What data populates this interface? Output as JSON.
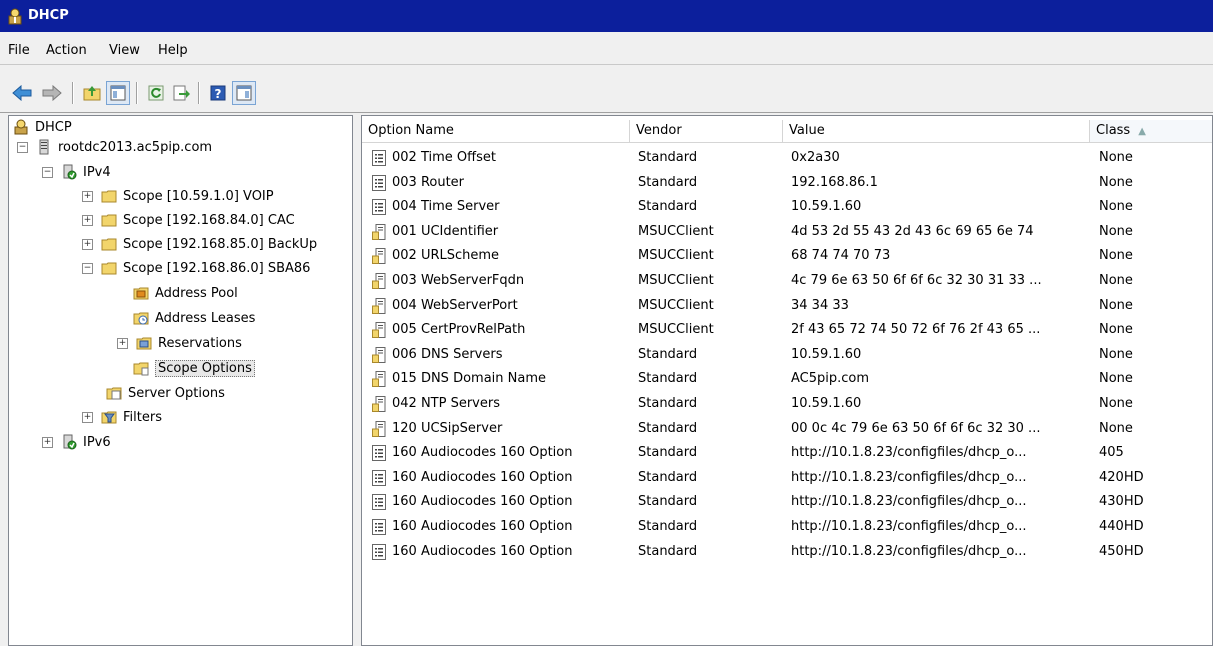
{
  "window": {
    "title": "DHCP"
  },
  "menu": [
    "File",
    "Action",
    "View",
    "Help"
  ],
  "toolbar": [
    "back-icon",
    "forward-icon",
    "up-folder-icon",
    "show-hide-tree-icon",
    "refresh-icon",
    "export-list-icon",
    "help-icon",
    "show-hide-action-pane-icon"
  ],
  "tree": {
    "root": "DHCP",
    "server": "rootdc2013.ac5pip.com",
    "ipv4": "IPv4",
    "scopes": [
      "Scope [10.59.1.0] VOIP",
      "Scope [192.168.84.0] CAC",
      "Scope [192.168.85.0] BackUp",
      "Scope [192.168.86.0] SBA86"
    ],
    "scope_children": {
      "address_pool": "Address Pool",
      "address_leases": "Address Leases",
      "reservations": "Reservations",
      "scope_options": "Scope Options"
    },
    "server_options": "Server Options",
    "filters": "Filters",
    "ipv6": "IPv6"
  },
  "list": {
    "columns": {
      "name": "Option Name",
      "vendor": "Vendor",
      "value": "Value",
      "class": "Class"
    },
    "rows": [
      {
        "name": "002 Time Offset",
        "vendor": "Standard",
        "value": "0x2a30",
        "class": "None",
        "icon": "std"
      },
      {
        "name": "003 Router",
        "vendor": "Standard",
        "value": "192.168.86.1",
        "class": "None",
        "icon": "std"
      },
      {
        "name": "004 Time Server",
        "vendor": "Standard",
        "value": "10.59.1.60",
        "class": "None",
        "icon": "std"
      },
      {
        "name": "001 UCIdentifier",
        "vendor": "MSUCClient",
        "value": "4d 53 2d 55 43 2d 43 6c 69 65 6e 74",
        "class": "None",
        "icon": "scope"
      },
      {
        "name": "002 URLScheme",
        "vendor": "MSUCClient",
        "value": "68 74 74 70 73",
        "class": "None",
        "icon": "scope"
      },
      {
        "name": "003 WebServerFqdn",
        "vendor": "MSUCClient",
        "value": "4c 79 6e 63 50 6f 6f 6c 32 30 31 33 ...",
        "class": "None",
        "icon": "scope"
      },
      {
        "name": "004 WebServerPort",
        "vendor": "MSUCClient",
        "value": "34 34 33",
        "class": "None",
        "icon": "scope"
      },
      {
        "name": "005 CertProvRelPath",
        "vendor": "MSUCClient",
        "value": "2f 43 65 72 74 50 72 6f 76 2f 43 65 ...",
        "class": "None",
        "icon": "scope"
      },
      {
        "name": "006 DNS Servers",
        "vendor": "Standard",
        "value": "10.59.1.60",
        "class": "None",
        "icon": "scope"
      },
      {
        "name": "015 DNS Domain Name",
        "vendor": "Standard",
        "value": "AC5pip.com",
        "class": "None",
        "icon": "scope"
      },
      {
        "name": "042 NTP Servers",
        "vendor": "Standard",
        "value": "10.59.1.60",
        "class": "None",
        "icon": "scope"
      },
      {
        "name": "120 UCSipServer",
        "vendor": "Standard",
        "value": "00 0c 4c 79 6e 63 50 6f 6f 6c 32 30 ...",
        "class": "None",
        "icon": "scope"
      },
      {
        "name": "160 Audiocodes 160 Option",
        "vendor": "Standard",
        "value": "http://10.1.8.23/configfiles/dhcp_o...",
        "class": "405",
        "icon": "std"
      },
      {
        "name": "160 Audiocodes 160 Option",
        "vendor": "Standard",
        "value": "http://10.1.8.23/configfiles/dhcp_o...",
        "class": "420HD",
        "icon": "std"
      },
      {
        "name": "160 Audiocodes 160 Option",
        "vendor": "Standard",
        "value": "http://10.1.8.23/configfiles/dhcp_o...",
        "class": "430HD",
        "icon": "std"
      },
      {
        "name": "160 Audiocodes 160 Option",
        "vendor": "Standard",
        "value": "http://10.1.8.23/configfiles/dhcp_o...",
        "class": "440HD",
        "icon": "std"
      },
      {
        "name": "160 Audiocodes 160 Option",
        "vendor": "Standard",
        "value": "http://10.1.8.23/configfiles/dhcp_o...",
        "class": "450HD",
        "icon": "std"
      }
    ]
  },
  "colors": {
    "titlebar": "#0c1f9c",
    "window": "#f0f0f0",
    "pane": "#ffffff",
    "folder": "#f2d56b"
  }
}
